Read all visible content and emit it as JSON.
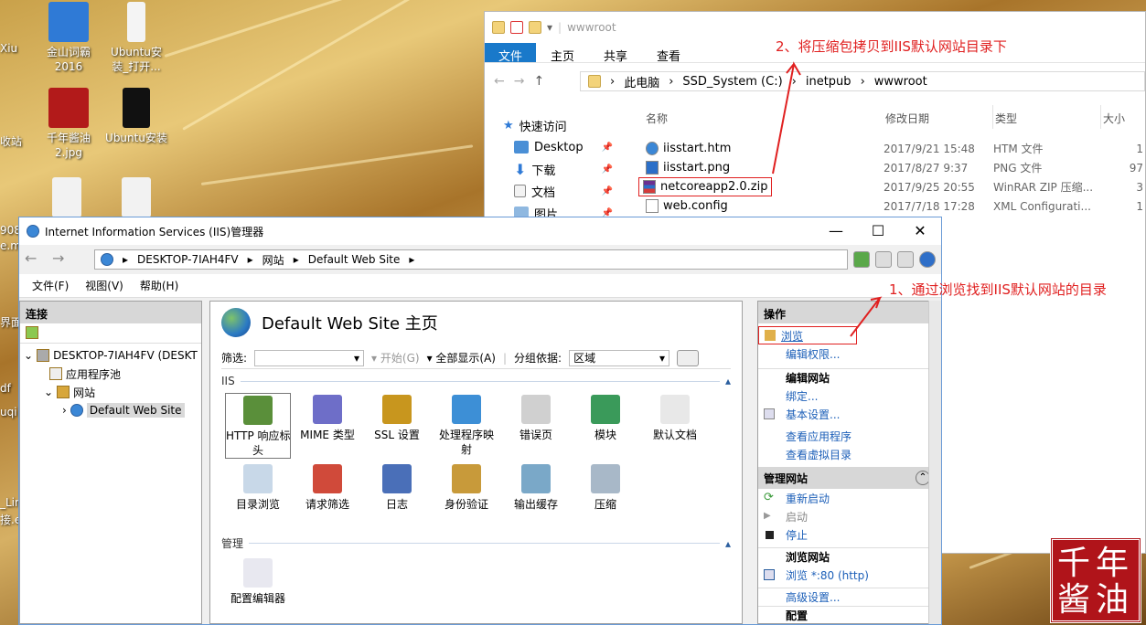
{
  "desktop": {
    "icons": [
      {
        "label": "金山词霸\n2016",
        "color": "#2f7ad6"
      },
      {
        "label": "Ubuntu安\n装_打开...",
        "color": "#f4f4f4"
      },
      {
        "label": "千年酱油\n2.jpg",
        "color": "#b21a1a"
      },
      {
        "label": "Ubuntu安装",
        "color": "#111111"
      }
    ],
    "edge_texts": [
      "Xiu",
      "收站",
      "908",
      "e.m",
      "界面",
      "df",
      "uqi",
      "_Lin",
      "接.e"
    ]
  },
  "explorer": {
    "title": "wwwroot",
    "ribbon": [
      "文件",
      "主页",
      "共享",
      "查看"
    ],
    "path": [
      "此电脑",
      "SSD_System (C:)",
      "inetpub",
      "wwwroot"
    ],
    "quick_access": [
      {
        "label": "快速访问"
      },
      {
        "label": "Desktop"
      },
      {
        "label": "下载"
      },
      {
        "label": "文档"
      },
      {
        "label": "图片"
      }
    ],
    "columns": [
      "名称",
      "修改日期",
      "类型",
      "大小"
    ],
    "files": [
      {
        "name": "iisstart.htm",
        "date": "2017/9/21 15:48",
        "type": "HTM 文件",
        "size": "1"
      },
      {
        "name": "iisstart.png",
        "date": "2017/8/27 9:37",
        "type": "PNG 文件",
        "size": "97"
      },
      {
        "name": "netcoreapp2.0.zip",
        "date": "2017/9/25 20:55",
        "type": "WinRAR ZIP 压缩...",
        "size": "3"
      },
      {
        "name": "web.config",
        "date": "2017/7/18 17:28",
        "type": "XML Configurati...",
        "size": "1"
      }
    ]
  },
  "annotations": {
    "a2": "2、将压缩包拷贝到IIS默认网站目录下",
    "a1": "1、通过浏览找到IIS默认网站的目录"
  },
  "iis": {
    "title": "Internet Information Services (IIS)管理器",
    "path": [
      "DESKTOP-7IAH4FV",
      "网站",
      "Default Web Site"
    ],
    "menu": [
      "文件(F)",
      "视图(V)",
      "帮助(H)"
    ],
    "connections_header": "连接",
    "tree": {
      "server": "DESKTOP-7IAH4FV (DESKT",
      "apppools": "应用程序池",
      "sites": "网站",
      "site": "Default Web Site"
    },
    "page_title": "Default Web Site 主页",
    "filter_label": "筛选:",
    "start_label": "开始(G)",
    "show_all": "全部显示(A)",
    "group_label": "分组依据:",
    "group_value": "区域",
    "group_iis": "IIS",
    "group_mgmt": "管理",
    "features": [
      {
        "label": "HTTP 响应标\n头",
        "color": "#5a8f3a"
      },
      {
        "label": "MIME 类型",
        "color": "#6e6ec8"
      },
      {
        "label": "SSL 设置",
        "color": "#c8961e"
      },
      {
        "label": "处理程序映\n射",
        "color": "#3d8fd6"
      },
      {
        "label": "错误页",
        "color": "#d0d0d0"
      },
      {
        "label": "模块",
        "color": "#3a9a5a"
      },
      {
        "label": "默认文档",
        "color": "#e8e8e8"
      },
      {
        "label": "目录浏览",
        "color": "#c8d8e8"
      },
      {
        "label": "请求筛选",
        "color": "#d04a3a"
      },
      {
        "label": "日志",
        "color": "#4a6fb8"
      },
      {
        "label": "身份验证",
        "color": "#c89a3a"
      },
      {
        "label": "输出缓存",
        "color": "#7aa8c8"
      },
      {
        "label": "压缩",
        "color": "#a8b8c8"
      }
    ],
    "mgmt_features": [
      {
        "label": "配置编辑器",
        "color": "#e8e8f0"
      }
    ],
    "actions": {
      "header": "操作",
      "browse": "浏览",
      "edit_perm": "编辑权限...",
      "edit_site": "编辑网站",
      "bind": "绑定...",
      "basic": "基本设置...",
      "view_app": "查看应用程序",
      "view_vdir": "查看虚拟目录",
      "manage": "管理网站",
      "restart": "重新启动",
      "start": "启动",
      "stop": "停止",
      "browse_site": "浏览网站",
      "browse80": "浏览 *:80 (http)",
      "advanced": "高级设置...",
      "config": "配置"
    }
  },
  "stamp": "千年\n酱油"
}
